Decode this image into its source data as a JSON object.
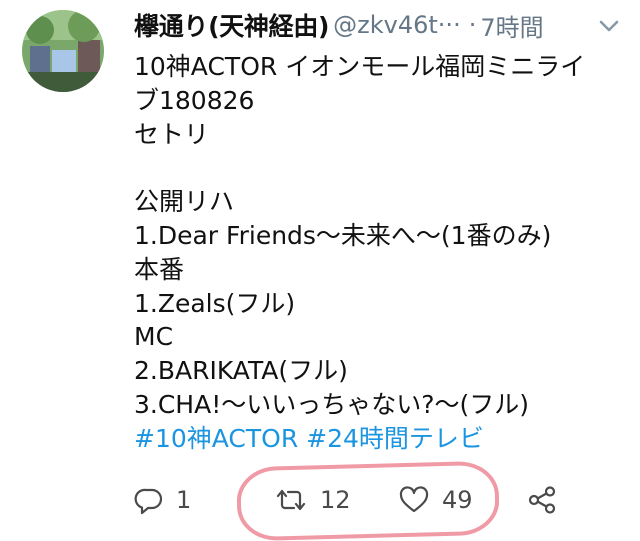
{
  "tweet": {
    "display_name": "欅通り(天神経由)",
    "handle": "@zkv46t···",
    "separator": "·",
    "time": "7時間",
    "lines": [
      "10神ACTOR イオンモール福岡ミニライ",
      "ブ180826",
      "セトリ",
      "",
      "公開リハ",
      "1.Dear Friends〜未来へ〜(1番のみ)",
      "本番",
      "1.Zeals(フル)",
      "MC",
      "2.BARIKATA(フル)",
      "3.CHA!〜いいっちゃない?〜(フル)"
    ],
    "hashtags": "#10神ACTOR #24時間テレビ"
  },
  "actions": {
    "reply_count": "1",
    "retweet_count": "12",
    "like_count": "49"
  },
  "icons": {
    "avatar": "avatar-photo",
    "caret": "chevron-down-icon",
    "reply": "reply-icon",
    "retweet": "retweet-icon",
    "like": "heart-icon",
    "share": "share-icon"
  },
  "colors": {
    "link": "#1b95e0",
    "muted": "#657786",
    "highlight": "#f09aa6"
  }
}
